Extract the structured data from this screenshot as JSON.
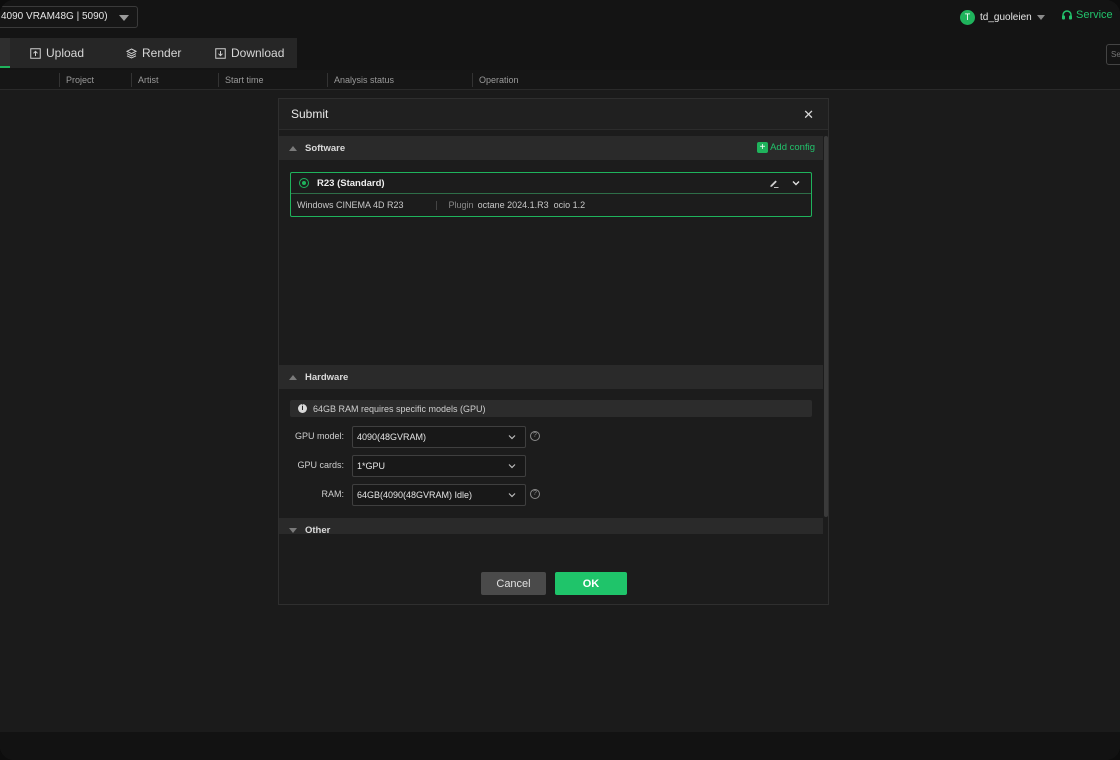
{
  "topbar": {
    "machine_select": "4090 VRAM48G | 5090)",
    "user": {
      "avatar_letter": "T",
      "name": "td_guoleien"
    },
    "service_label": "Service"
  },
  "nav": {
    "tabs": [
      {
        "label": "Upload",
        "icon": "upload-icon"
      },
      {
        "label": "Render",
        "icon": "layers-icon"
      },
      {
        "label": "Download",
        "icon": "download-icon"
      }
    ],
    "search_placeholder": "Se"
  },
  "table": {
    "columns": [
      "Project",
      "Artist",
      "Start time",
      "Analysis status",
      "Operation"
    ]
  },
  "modal": {
    "title": "Submit",
    "software": {
      "heading": "Software",
      "add_config_label": "Add config",
      "card": {
        "name": "R23 (Standard)",
        "platform": "Windows CINEMA 4D R23",
        "plugin_label": "Plugin",
        "plugins": "octane 2024.1.R3  ocio 1.2"
      }
    },
    "hardware": {
      "heading": "Hardware",
      "notice": "64GB RAM requires specific models (GPU)",
      "gpu_model": {
        "label": "GPU model:",
        "value": "4090(48GVRAM)"
      },
      "gpu_cards": {
        "label": "GPU cards:",
        "value": "1*GPU"
      },
      "ram": {
        "label": "RAM:",
        "value": "64GB(4090(48GVRAM) Idle)"
      }
    },
    "other": {
      "heading": "Other"
    },
    "buttons": {
      "cancel": "Cancel",
      "ok": "OK"
    }
  },
  "colors": {
    "accent": "#1fb35c",
    "ok_button": "#1fc46a",
    "background": "#1b1b1b"
  }
}
